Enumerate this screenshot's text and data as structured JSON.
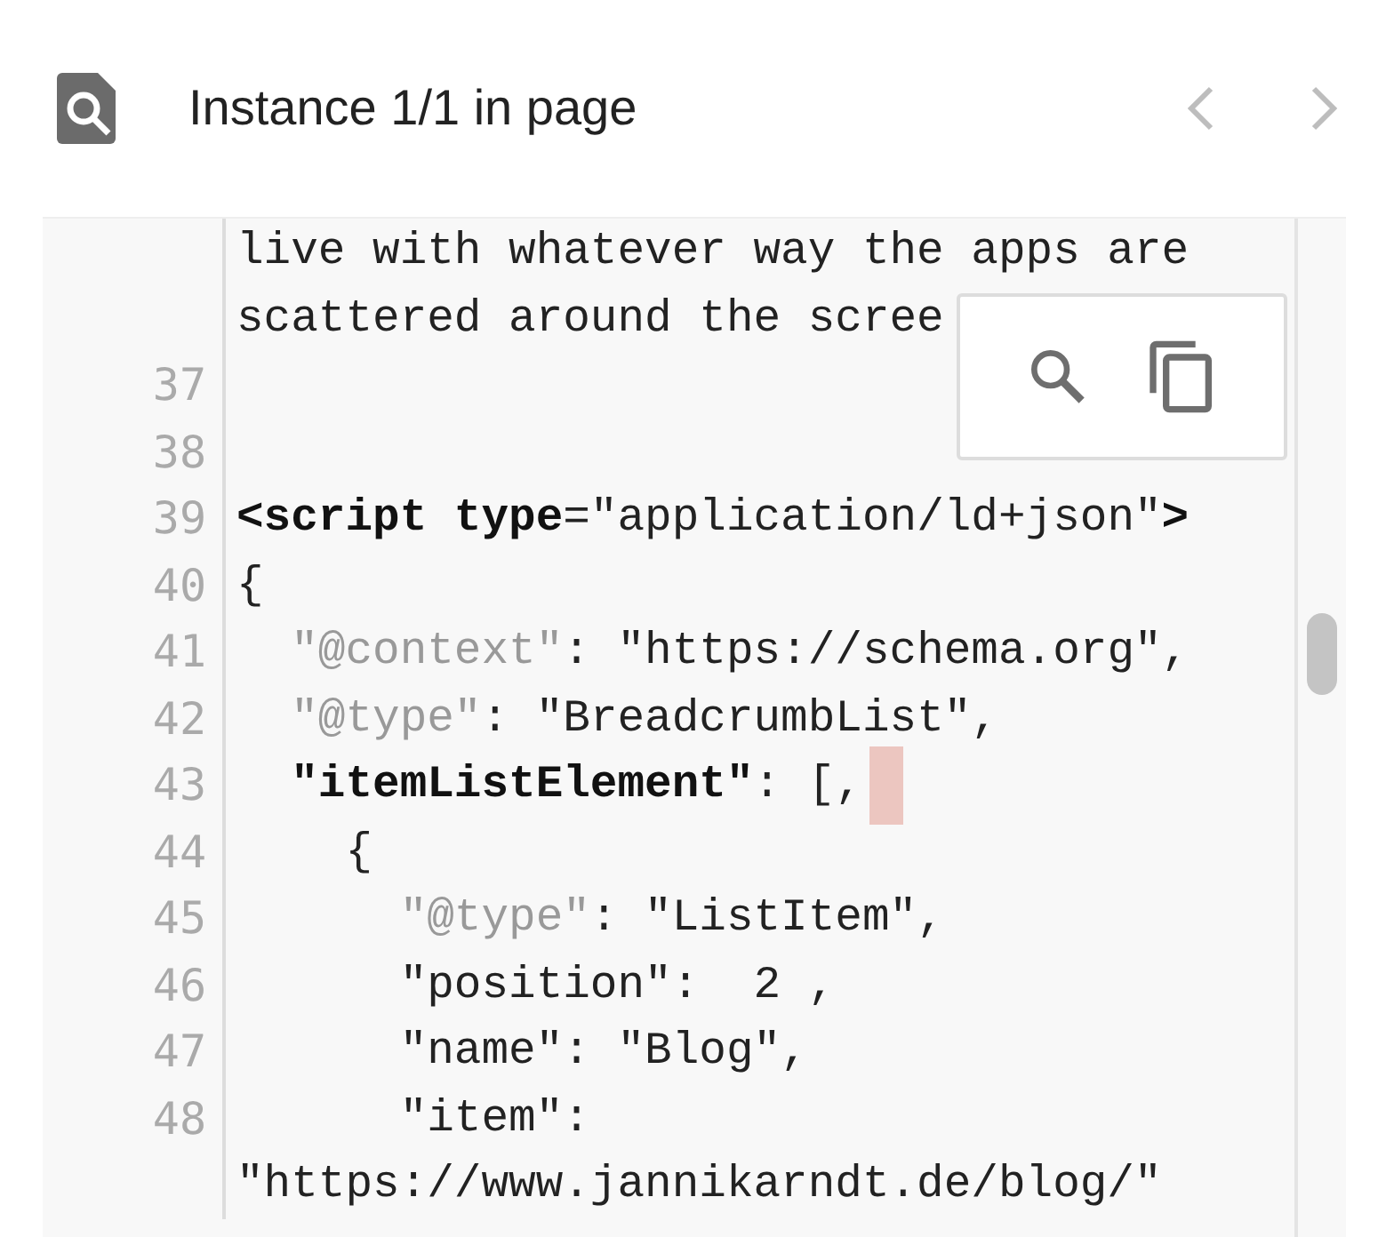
{
  "header": {
    "title": "Instance 1/1 in page"
  },
  "code": {
    "lines": [
      {
        "segments": [
          {
            "kind": "plain",
            "text": "live with whatever way the apps are"
          }
        ]
      },
      {
        "segments": [
          {
            "kind": "plain",
            "text": "scattered around the scree"
          }
        ]
      },
      {
        "number": "37"
      },
      {
        "number": "38"
      },
      {
        "number": "39",
        "segments": [
          {
            "kind": "bold",
            "text": "<script"
          },
          {
            "kind": "bold",
            "text": " type"
          },
          {
            "kind": "plain",
            "text": "=\"application/ld+json\""
          },
          {
            "kind": "bold",
            "text": ">"
          }
        ]
      },
      {
        "number": "40",
        "segments": [
          {
            "kind": "plain",
            "text": "{"
          }
        ]
      },
      {
        "number": "41",
        "segments": [
          {
            "kind": "key",
            "text": "  \"@context\""
          },
          {
            "kind": "plain",
            "text": ": \"https://schema.org\","
          }
        ]
      },
      {
        "number": "42",
        "segments": [
          {
            "kind": "key",
            "text": "  \"@type\""
          },
          {
            "kind": "plain",
            "text": ": \"BreadcrumbList\","
          }
        ]
      },
      {
        "number": "43",
        "marker": true,
        "segments": [
          {
            "kind": "bold",
            "text": "  \"itemListElement\""
          },
          {
            "kind": "plain",
            "text": ": [,"
          }
        ]
      },
      {
        "number": "44",
        "segments": [
          {
            "kind": "plain",
            "text": "    {"
          }
        ]
      },
      {
        "number": "45",
        "segments": [
          {
            "kind": "key",
            "text": "      \"@type\""
          },
          {
            "kind": "plain",
            "text": ": \"ListItem\","
          }
        ]
      },
      {
        "number": "46",
        "segments": [
          {
            "kind": "plain",
            "text": "      \"position\":  2 ,"
          }
        ]
      },
      {
        "number": "47",
        "segments": [
          {
            "kind": "plain",
            "text": "      \"name\": \"Blog\","
          }
        ]
      },
      {
        "number": "48",
        "segments": [
          {
            "kind": "plain",
            "text": "      \"item\":"
          }
        ]
      },
      {
        "segments": [
          {
            "kind": "plain",
            "text": "\"https://www.jannikarndt.de/blog/\""
          }
        ]
      }
    ]
  }
}
